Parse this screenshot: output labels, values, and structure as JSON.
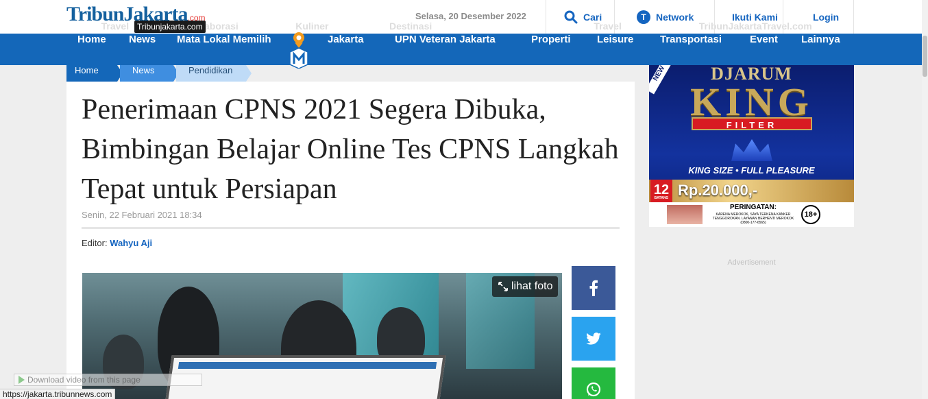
{
  "header": {
    "logo_main": "TribunJakarta",
    "logo_domain": ".com",
    "logo_tooltip": "Tribunjakarta.com",
    "date": "Selasa, 20 Desember 2022",
    "search_label": "Cari",
    "network_label": "Network",
    "follow_label": "Ikuti Kami",
    "login_label": "Login",
    "background_strip": [
      "Travel",
      "Kolaborasi",
      "Kuliner",
      "Destinasi",
      "",
      "Travel",
      "TribunJakartaTravel.com"
    ]
  },
  "nav": {
    "items": [
      "Home",
      "News",
      "Mata Lokal Memilih",
      "Jakarta",
      "UPN Veteran Jakarta",
      "Properti",
      "Leisure",
      "Transportasi",
      "Event",
      "Lainnya"
    ]
  },
  "breadcrumb": [
    "Home",
    "News",
    "Pendidikan"
  ],
  "article": {
    "title": "Penerimaan CPNS 2021 Segera Dibuka, Bimbingan Belajar Online Tes CPNS Langkah Tepat untuk Persiapan",
    "date": "Senin, 22 Februari 2021 18:34",
    "editor_label": "Editor:",
    "editor_name": "Wahyu Aji",
    "photo_button": "lihat foto"
  },
  "share": {
    "facebook_icon": "facebook-icon",
    "twitter_icon": "twitter-icon",
    "whatsapp_icon": "whatsapp-icon"
  },
  "ad": {
    "badge": "NEW",
    "brand": "DJARUM",
    "product": "KING",
    "variant": "FILTER",
    "tagline": "KING SIZE • FULL PLEASURE",
    "count": "12",
    "count_unit": "BATANG",
    "price": "Rp.20.000,-",
    "warning_title": "PERINGATAN:",
    "warning_text": "KARENA MEROKOK, SAYA TERKENA KANKER TENGGOROKAN. LAYANAN BERHENTI MEROKOK (0800-177-6565)",
    "age": "18+"
  },
  "advertisement_label": "Advertisement",
  "overlay": {
    "download_video": "Download video from this page",
    "status_url": "https://jakarta.tribunnews.com"
  },
  "colors": {
    "nav_blue": "#1467b9",
    "link_blue": "#1565c0",
    "facebook": "#3b5998",
    "twitter": "#2aa3ef",
    "whatsapp": "#25b93f"
  }
}
